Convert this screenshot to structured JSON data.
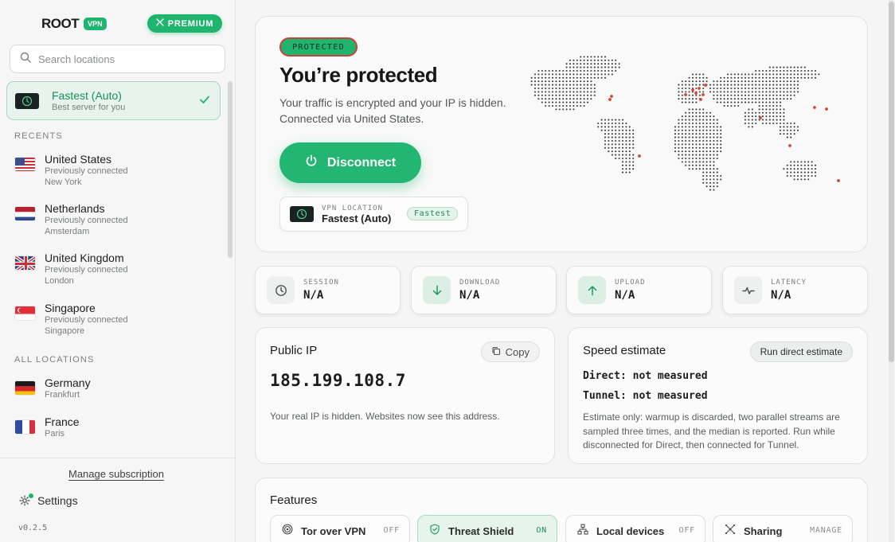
{
  "brand": {
    "name": "ROOT",
    "badge": "VPN",
    "premium_label": "PREMIUM"
  },
  "search": {
    "placeholder": "Search locations"
  },
  "selected_location": {
    "title": "Fastest (Auto)",
    "subtitle": "Best server for you"
  },
  "sections": {
    "recents": "RECENTS",
    "all": "ALL LOCATIONS"
  },
  "recents": [
    {
      "name": "United States",
      "status": "Previously connected",
      "city": "New York",
      "flag": "us"
    },
    {
      "name": "Netherlands",
      "status": "Previously connected",
      "city": "Amsterdam",
      "flag": "nl"
    },
    {
      "name": "United Kingdom",
      "status": "Previously connected",
      "city": "London",
      "flag": "uk"
    },
    {
      "name": "Singapore",
      "status": "Previously connected",
      "city": "Singapore",
      "flag": "sg"
    }
  ],
  "all_locations": [
    {
      "name": "Germany",
      "city": "Frankfurt",
      "flag": "de"
    },
    {
      "name": "France",
      "city": "Paris",
      "flag": "fr"
    }
  ],
  "sidebar_footer": {
    "manage": "Manage subscription",
    "settings": "Settings",
    "version": "v0.2.5"
  },
  "hero": {
    "badge": "PROTECTED",
    "title": "You’re protected",
    "line1": "Your traffic is encrypted and your IP is hidden.",
    "line2": "Connected via United States.",
    "disconnect": "Disconnect",
    "vpn_location_label": "VPN LOCATION",
    "vpn_location_value": "Fastest (Auto)",
    "vpn_location_tag": "Fastest"
  },
  "stats": [
    {
      "label": "SESSION",
      "value": "N/A",
      "icon": "clock-icon"
    },
    {
      "label": "DOWNLOAD",
      "value": "N/A",
      "icon": "arrow-down-icon"
    },
    {
      "label": "UPLOAD",
      "value": "N/A",
      "icon": "arrow-up-icon"
    },
    {
      "label": "LATENCY",
      "value": "N/A",
      "icon": "pulse-icon"
    }
  ],
  "public_ip": {
    "title": "Public IP",
    "copy": "Copy",
    "ip": "185.199.108.7",
    "note": "Your real IP is hidden. Websites now see this address."
  },
  "speed": {
    "title": "Speed estimate",
    "button": "Run direct estimate",
    "direct": "Direct: not measured",
    "tunnel": "Tunnel: not measured",
    "note": "Estimate only: warmup is discarded, two parallel streams are sampled three times, and the median is reported. Run while disconnected for Direct, then connected for Tunnel."
  },
  "features": {
    "title": "Features",
    "items": [
      {
        "label": "Tor over VPN",
        "state": "OFF",
        "icon": "tor-icon"
      },
      {
        "label": "Threat Shield",
        "state": "ON",
        "icon": "shield-icon"
      },
      {
        "label": "Local devices",
        "state": "OFF",
        "icon": "network-icon"
      },
      {
        "label": "Sharing",
        "state": "MANAGE",
        "icon": "share-icon"
      }
    ]
  },
  "colors": {
    "accent": "#20b56f",
    "text": "#1b1d1c",
    "muted": "#7b807d"
  }
}
